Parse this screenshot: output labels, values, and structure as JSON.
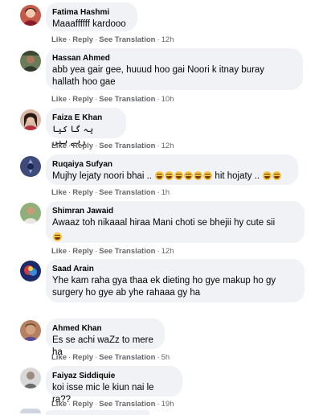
{
  "actions": {
    "like": "Like",
    "reply": "Reply",
    "translate": "See Translation",
    "dot": "·"
  },
  "comments": [
    {
      "author": "Fatima Hashmi",
      "text": "Maaaffffff kardooo",
      "time": "12h"
    },
    {
      "author": "Hassan Ahmed",
      "text": "abb yea gair gee, huuud hoo gai Noori k itnay buray\nhallath hoo gae",
      "time": "10h"
    },
    {
      "author": "Faiza E Khan",
      "text": "یہ گا کیا رہے ہیں",
      "time": "12h"
    },
    {
      "author": "Ruqaiya Sufyan",
      "text_a": "Mujhy lejaty noori bhai ..",
      "text_b": "hit hojaty ..",
      "time": "1h"
    },
    {
      "author": "Shimran Jawaid",
      "text": "Awaaz toh nikaaal hiraa Mani choti se bhejii hy cute sii",
      "time": "12h"
    },
    {
      "author": "Saad Arain",
      "text": "Yhe kam raha gya thaa ek dieting ho gye makup ho gy\nsurgery ho gye ab yhe rahaaa gy ha",
      "time": ""
    },
    {
      "author": "Ahmed Khan",
      "text": "Es se achi waZz to mere ha",
      "time": "5h"
    },
    {
      "author": "Faiyaz Siddiquie",
      "text": "koi isse mic le kiun nai le ra??",
      "time": "19h"
    }
  ]
}
